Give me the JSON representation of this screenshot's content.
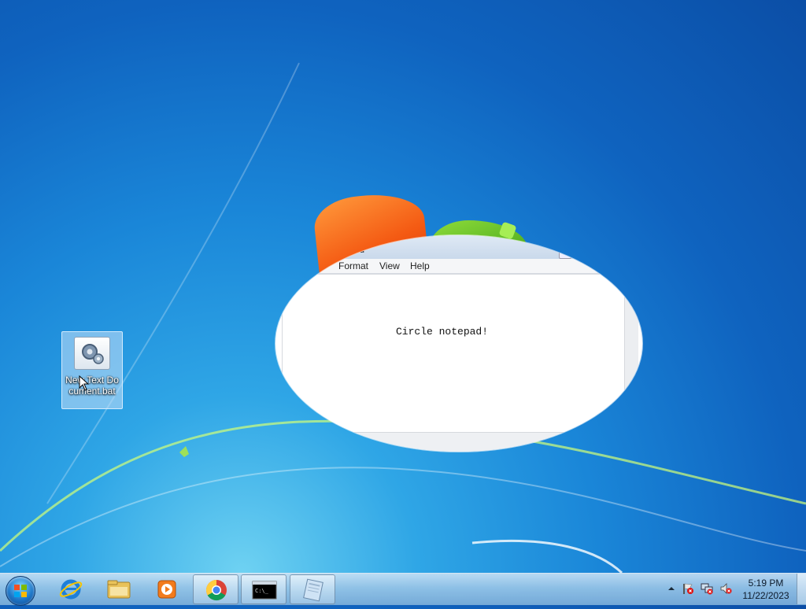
{
  "desktop": {
    "icons": [
      {
        "label": "New Text Document.bat"
      }
    ]
  },
  "notepad": {
    "title_fragment": "pad",
    "menu": [
      "Format",
      "View",
      "Help"
    ],
    "content": "Circle notepad!"
  },
  "taskbar": {
    "pinned": [
      {
        "name": "internet-explorer"
      },
      {
        "name": "windows-explorer"
      },
      {
        "name": "windows-media-player"
      },
      {
        "name": "google-chrome"
      },
      {
        "name": "command-prompt"
      },
      {
        "name": "notepad"
      }
    ],
    "clock": {
      "time": "5:19 PM",
      "date": "11/22/2023"
    }
  }
}
